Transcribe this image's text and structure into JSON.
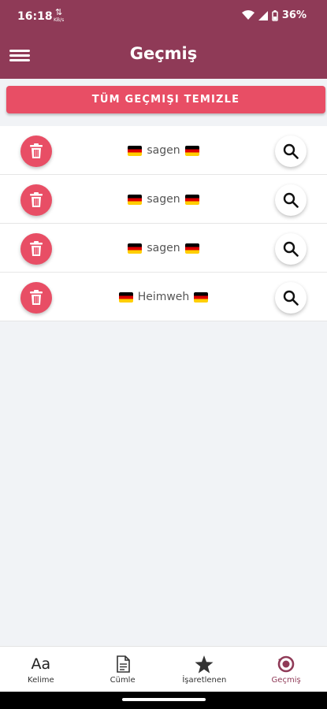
{
  "status_bar": {
    "time": "16:18",
    "indicator": "KB/s",
    "battery": "36%"
  },
  "app_bar": {
    "title": "Geçmiş",
    "menu_icon": "hamburger-menu-icon"
  },
  "clear_button_label": "TÜM GEÇMIŞI TEMIZLE",
  "history": [
    {
      "word": "sagen",
      "flag": "german-flag"
    },
    {
      "word": "sagen",
      "flag": "german-flag"
    },
    {
      "word": "sagen",
      "flag": "german-flag"
    },
    {
      "word": "Heimweh",
      "flag": "german-flag"
    }
  ],
  "bottom_nav": [
    {
      "label": "Kelime",
      "icon": "font-icon",
      "icon_text": "Aa"
    },
    {
      "label": "Cümle",
      "icon": "document-icon"
    },
    {
      "label": "İşaretlenen",
      "icon": "star-icon"
    },
    {
      "label": "Geçmiş",
      "icon": "history-icon",
      "active": true
    }
  ],
  "colors": {
    "primary": "#8f3a57",
    "accent": "#e84e65",
    "background": "#f1f3f6"
  }
}
